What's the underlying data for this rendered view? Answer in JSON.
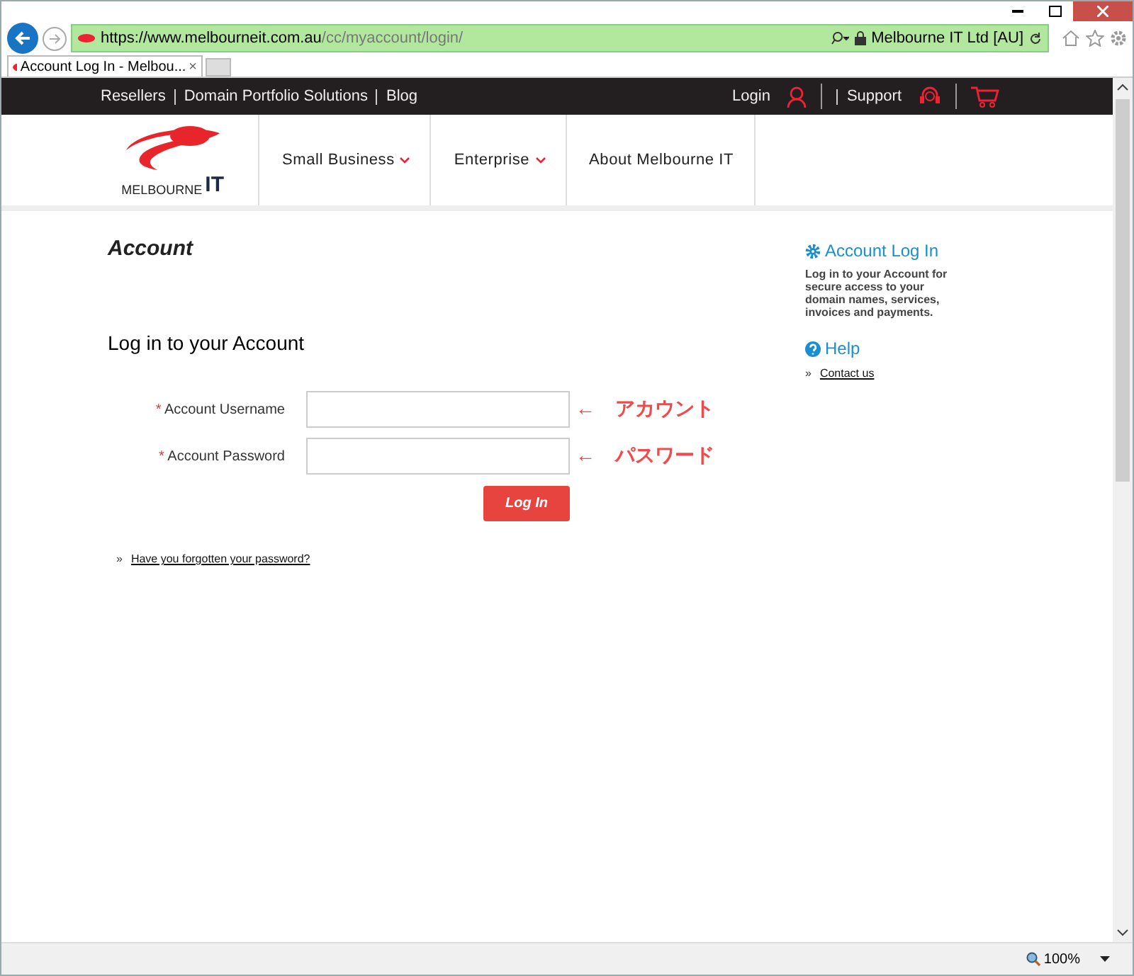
{
  "browser": {
    "url_host": "https://www.melbourneit.com.au",
    "url_path": "/cc/myaccount/login/",
    "site_identity": "Melbourne IT Ltd [AU]",
    "tabs": [
      {
        "title": "Account Log In - Melbou...",
        "close": "×",
        "selected": true
      }
    ],
    "zoom": "100%"
  },
  "top_bar": {
    "links": [
      "Resellers",
      "Domain Portfolio Solutions",
      "Blog"
    ],
    "login": "Login",
    "support": "Support"
  },
  "logo": {
    "word": "MELBOURNE",
    "mark": "IT"
  },
  "nav": [
    {
      "label": "Small Business",
      "dropdown": true
    },
    {
      "label": "Enterprise",
      "dropdown": true
    },
    {
      "label": "About Melbourne IT",
      "dropdown": false
    }
  ],
  "main": {
    "title": "Account",
    "heading": "Log in to your Account",
    "required_mark": "*",
    "fields": [
      {
        "label": "Account Username",
        "required": true,
        "arrow": "←",
        "annotation": "アカウント"
      },
      {
        "label": "Account Password",
        "required": true,
        "arrow": "←",
        "annotation": "パスワード"
      }
    ],
    "submit": "Log In",
    "bullet": "»",
    "forgot_link": "Have you forgotten your password?"
  },
  "sidebar": {
    "login_title": "Account Log In",
    "login_text": "Log in to your Account for secure access to your domain names, services, invoices and payments.",
    "help_title": "Help",
    "bullet": "»",
    "contact_link": "Contact us"
  }
}
